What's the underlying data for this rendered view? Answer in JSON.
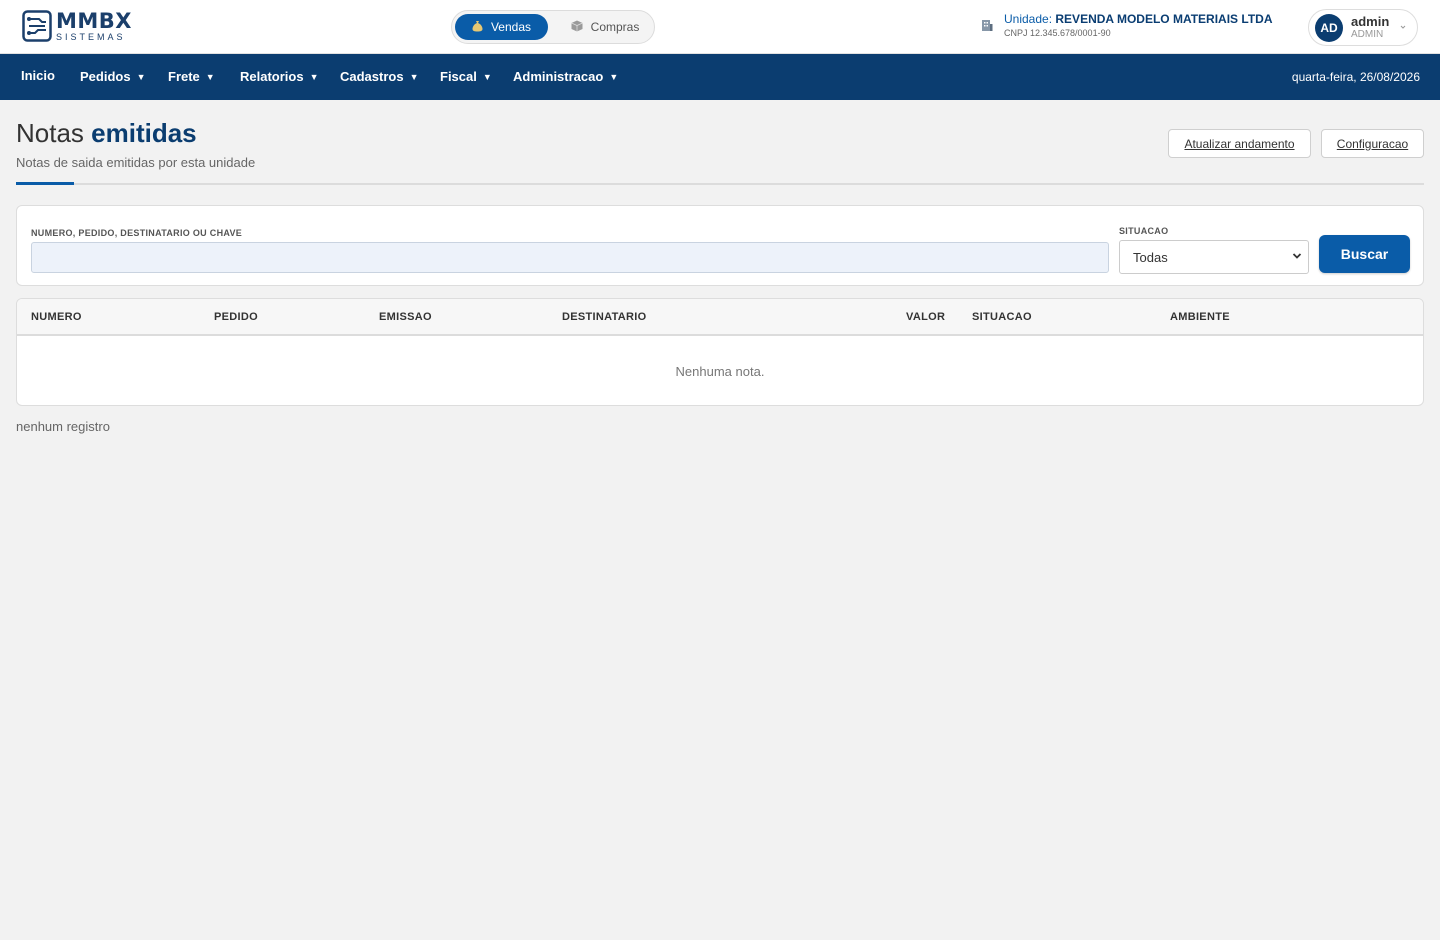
{
  "brand": {
    "logo_main": "MMBX",
    "logo_sub": "SISTEMAS"
  },
  "mode_switch": {
    "active_label": "Vendas",
    "inactive_label": "Compras"
  },
  "unit": {
    "prefix": "Unidade:",
    "name": "REVENDA MODELO MATERIAIS LTDA",
    "cnpj": "CNPJ 12.345.678/0001-90"
  },
  "user": {
    "initials": "AD",
    "name": "admin",
    "role": "ADMIN"
  },
  "nav": {
    "items": [
      {
        "label": "Inicio"
      },
      {
        "label": "Pedidos"
      },
      {
        "label": "Frete"
      },
      {
        "label": "Relatorios"
      },
      {
        "label": "Cadastros"
      },
      {
        "label": "Fiscal"
      },
      {
        "label": "Administracao"
      }
    ],
    "date": "quarta-feira, 26/08/2026"
  },
  "page": {
    "title_light": "Notas",
    "title_bold": "emitidas",
    "subtitle": "Notas de saida emitidas por esta unidade",
    "actions": {
      "refresh": "Atualizar andamento",
      "config": "Configuracao"
    }
  },
  "filters": {
    "search_label": "NUMERO, PEDIDO, DESTINATARIO OU CHAVE",
    "search_value": "",
    "status_label": "SITUACAO",
    "status_value": "Todas",
    "submit_label": "Buscar"
  },
  "table": {
    "columns": [
      "NUMERO",
      "PEDIDO",
      "EMISSAO",
      "DESTINATARIO",
      "VALOR",
      "SITUACAO",
      "AMBIENTE"
    ],
    "empty_message": "Nenhuma nota."
  },
  "footer": {
    "count_text": "nenhum registro"
  },
  "colors": {
    "primary": "#0a5ca8",
    "navbar": "#0b3d70",
    "background": "#f2f2f2"
  },
  "icons": {
    "brand": "circuit-logo-icon",
    "vendas": "money-bag-icon",
    "compras": "box-icon",
    "unit": "building-icon",
    "user_menu": "chevron-down-icon",
    "select": "chevron-down-icon"
  }
}
